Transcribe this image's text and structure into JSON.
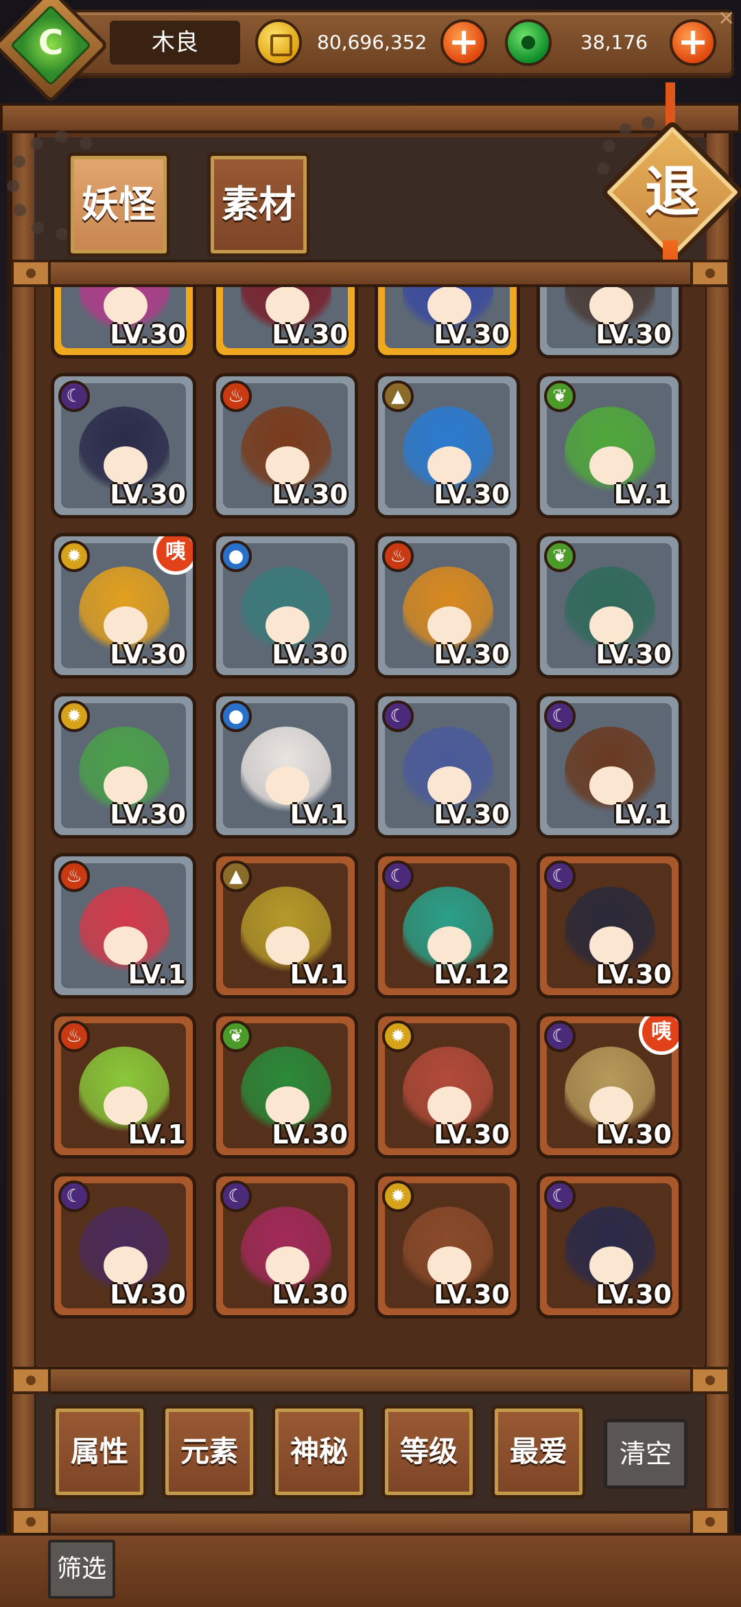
{
  "header": {
    "player_name": "木良",
    "gold_amount": "80,696,352",
    "jade_amount": "38,176",
    "plus_label": "+",
    "close_label": "✕"
  },
  "tabs": [
    {
      "label": "妖怪",
      "active": true
    },
    {
      "label": "素材",
      "active": false
    }
  ],
  "exit_label": "退",
  "badge_label": "咦",
  "cards": [
    {
      "level": "LV.30",
      "frame": "gold",
      "element": "",
      "art": "#b23a8a",
      "badge": false
    },
    {
      "level": "LV.30",
      "frame": "gold",
      "element": "",
      "art": "#7a1f2a",
      "badge": false
    },
    {
      "level": "LV.30",
      "frame": "gold",
      "element": "",
      "art": "#3a4aa0",
      "badge": false
    },
    {
      "level": "LV.30",
      "frame": "silver",
      "element": "",
      "art": "#4a3a34",
      "badge": false
    },
    {
      "level": "LV.30",
      "frame": "silver",
      "element": "dark",
      "art": "#2b2a4a",
      "badge": false
    },
    {
      "level": "LV.30",
      "frame": "silver",
      "element": "fire",
      "art": "#7a3a1a",
      "badge": false
    },
    {
      "level": "LV.30",
      "frame": "silver",
      "element": "earth",
      "art": "#2a7ad0",
      "badge": false
    },
    {
      "level": "LV.1",
      "frame": "silver",
      "element": "leaf",
      "art": "#4fa83a",
      "badge": false
    },
    {
      "level": "LV.30",
      "frame": "silver",
      "element": "light",
      "art": "#e2a01e",
      "badge": true
    },
    {
      "level": "LV.30",
      "frame": "silver",
      "element": "water",
      "art": "#3a7a7a",
      "badge": false
    },
    {
      "level": "LV.30",
      "frame": "silver",
      "element": "fire",
      "art": "#d9891e",
      "badge": false
    },
    {
      "level": "LV.30",
      "frame": "silver",
      "element": "leaf",
      "art": "#2f6a5a",
      "badge": false
    },
    {
      "level": "LV.30",
      "frame": "silver",
      "element": "light",
      "art": "#4aa04a",
      "badge": false
    },
    {
      "level": "LV.1",
      "frame": "silver",
      "element": "water",
      "art": "#eae4e0",
      "badge": false
    },
    {
      "level": "LV.30",
      "frame": "silver",
      "element": "dark",
      "art": "#4a5a9a",
      "badge": false
    },
    {
      "level": "LV.1",
      "frame": "silver",
      "element": "dark",
      "art": "#6a3a20",
      "badge": false
    },
    {
      "level": "LV.1",
      "frame": "silver",
      "element": "fire",
      "art": "#d23a4a",
      "badge": false
    },
    {
      "level": "LV.1",
      "frame": "bronze",
      "element": "earth",
      "art": "#b59a2a",
      "badge": false
    },
    {
      "level": "LV.12",
      "frame": "bronze",
      "element": "dark",
      "art": "#2aa08a",
      "badge": false
    },
    {
      "level": "LV.30",
      "frame": "bronze",
      "element": "dark",
      "art": "#2a2a3a",
      "badge": false
    },
    {
      "level": "LV.1",
      "frame": "bronze",
      "element": "fire",
      "art": "#8ac83a",
      "badge": false
    },
    {
      "level": "LV.30",
      "frame": "bronze",
      "element": "leaf",
      "art": "#2a8a3a",
      "badge": false
    },
    {
      "level": "LV.30",
      "frame": "bronze",
      "element": "light",
      "art": "#b24a3a",
      "badge": false
    },
    {
      "level": "LV.30",
      "frame": "bronze",
      "element": "dark",
      "art": "#b59a5a",
      "badge": true
    },
    {
      "level": "LV.30",
      "frame": "bronze",
      "element": "dark",
      "art": "#4a2a5a",
      "badge": false
    },
    {
      "level": "LV.30",
      "frame": "bronze",
      "element": "dark",
      "art": "#a22a5a",
      "badge": false
    },
    {
      "level": "LV.30",
      "frame": "bronze",
      "element": "light",
      "art": "#8a4a2a",
      "badge": false
    },
    {
      "level": "LV.30",
      "frame": "bronze",
      "element": "dark",
      "art": "#2a2a4a",
      "badge": false
    }
  ],
  "filters": {
    "buttons": [
      "属性",
      "元素",
      "神秘",
      "等级",
      "最爱"
    ],
    "clear_label": "清空",
    "toggle_label": "筛选"
  },
  "colors": {
    "wood": "#6e4022",
    "gold": "#e0a414",
    "jade": "#0f8d2b",
    "accent_orange": "#e0480e"
  }
}
